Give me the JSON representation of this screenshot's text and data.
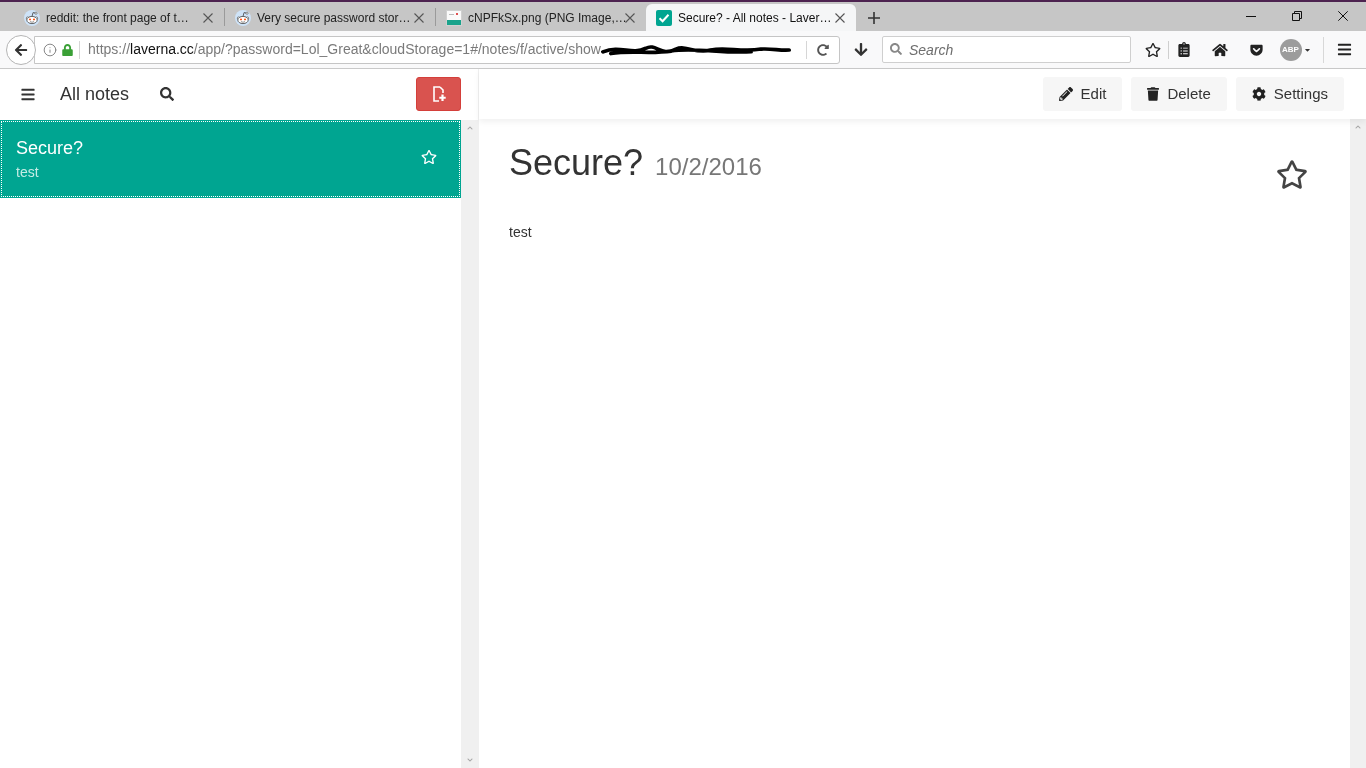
{
  "browser": {
    "tabs": [
      {
        "title": "reddit: the front page of t…",
        "selected": false
      },
      {
        "title": "Very secure password stor…",
        "selected": false
      },
      {
        "title": "cNPFkSx.png (PNG Image,…",
        "selected": false
      },
      {
        "title": "Secure? - All notes - Laver…",
        "selected": true
      }
    ],
    "url": {
      "scheme": "https://",
      "domain": "laverna.cc",
      "path": "/app/?password=Lol_Great&cloudStorage=1#/notes/f/active/show"
    },
    "search": {
      "placeholder": "Search"
    },
    "addon_badge": "ABP"
  },
  "sidebar": {
    "title": "All notes",
    "notes": [
      {
        "title": "Secure?",
        "preview": "test",
        "selected": true,
        "starred": false
      }
    ]
  },
  "toolbar": {
    "buttons": [
      {
        "label": "Edit"
      },
      {
        "label": "Delete"
      },
      {
        "label": "Settings"
      }
    ]
  },
  "note": {
    "title": "Secure?",
    "date": "10/2/2016",
    "body": "test",
    "starred": false
  }
}
